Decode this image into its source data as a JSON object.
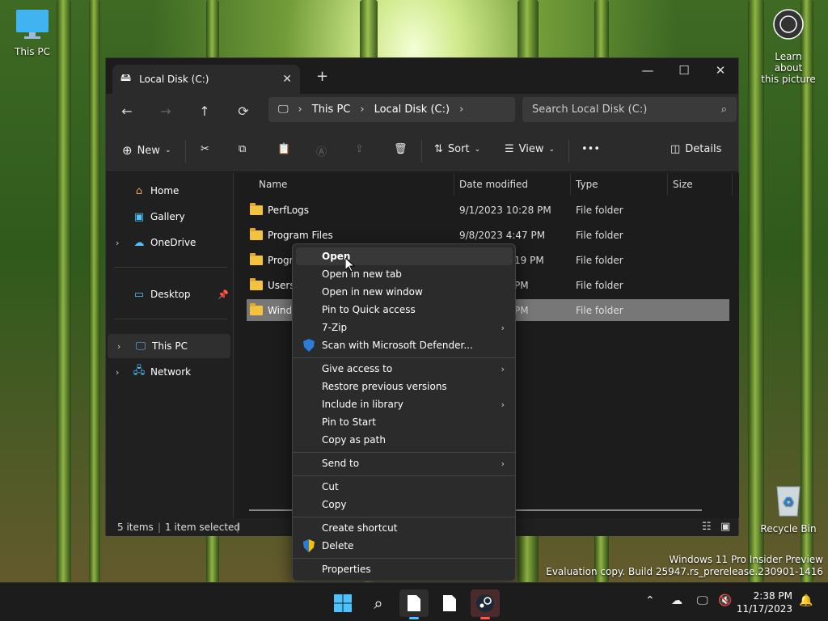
{
  "desktop": {
    "this_pc_label": "This PC",
    "learn_label_1": "Learn about",
    "learn_label_2": "this picture",
    "recycle_label": "Recycle Bin"
  },
  "window": {
    "tab_title": "Local Disk (C:)",
    "new_tab": "+",
    "minimize": "—",
    "maximize": "☐",
    "close": "✕",
    "address": {
      "crumbs": [
        "This PC",
        "Local Disk (C:)"
      ]
    },
    "search_placeholder": "Search Local Disk (C:)",
    "commands": {
      "new_label": "New",
      "sort_label": "Sort",
      "view_label": "View",
      "more_label": "•••",
      "details_label": "Details"
    },
    "sidebar": {
      "items": [
        {
          "label": "Home",
          "icon": "home-icon"
        },
        {
          "label": "Gallery",
          "icon": "gallery-icon"
        },
        {
          "label": "OneDrive",
          "icon": "cloud-icon"
        },
        {
          "label": "Desktop",
          "icon": "desktop-icon"
        },
        {
          "label": "This PC",
          "icon": "computer-icon"
        },
        {
          "label": "Network",
          "icon": "network-icon"
        }
      ]
    },
    "columns": [
      "Name",
      "Date modified",
      "Type",
      "Size"
    ],
    "files": [
      {
        "name": "PerfLogs",
        "date": "9/1/2023 10:28 PM",
        "type": "File folder"
      },
      {
        "name": "Program Files",
        "date": "9/8/2023 4:47 PM",
        "type": "File folder"
      },
      {
        "name": "Progra",
        "date": "19 PM",
        "type": "File folder"
      },
      {
        "name": "Users",
        "date": "PM",
        "type": "File folder"
      },
      {
        "name": "Windo",
        "date": "PM",
        "type": "File folder"
      }
    ],
    "status": {
      "items": "5 items",
      "selected": "1 item selected"
    }
  },
  "context_menu": {
    "items": [
      "Open",
      "Open in new tab",
      "Open in new window",
      "Pin to Quick access",
      "7-Zip",
      "Scan with Microsoft Defender...",
      "Give access to",
      "Restore previous versions",
      "Include in library",
      "Pin to Start",
      "Copy as path",
      "Send to",
      "Cut",
      "Copy",
      "Create shortcut",
      "Delete",
      "Properties"
    ]
  },
  "watermark": {
    "line1": "Windows 11 Pro Insider Preview",
    "line2": "Evaluation copy. Build 25947.rs_prerelease.230901-1416"
  },
  "taskbar": {
    "time": "2:38 PM",
    "date": "11/17/2023"
  },
  "colors": {
    "accent": "#4cc2ff",
    "selection": "#777777",
    "folder": "#f3c33f"
  }
}
